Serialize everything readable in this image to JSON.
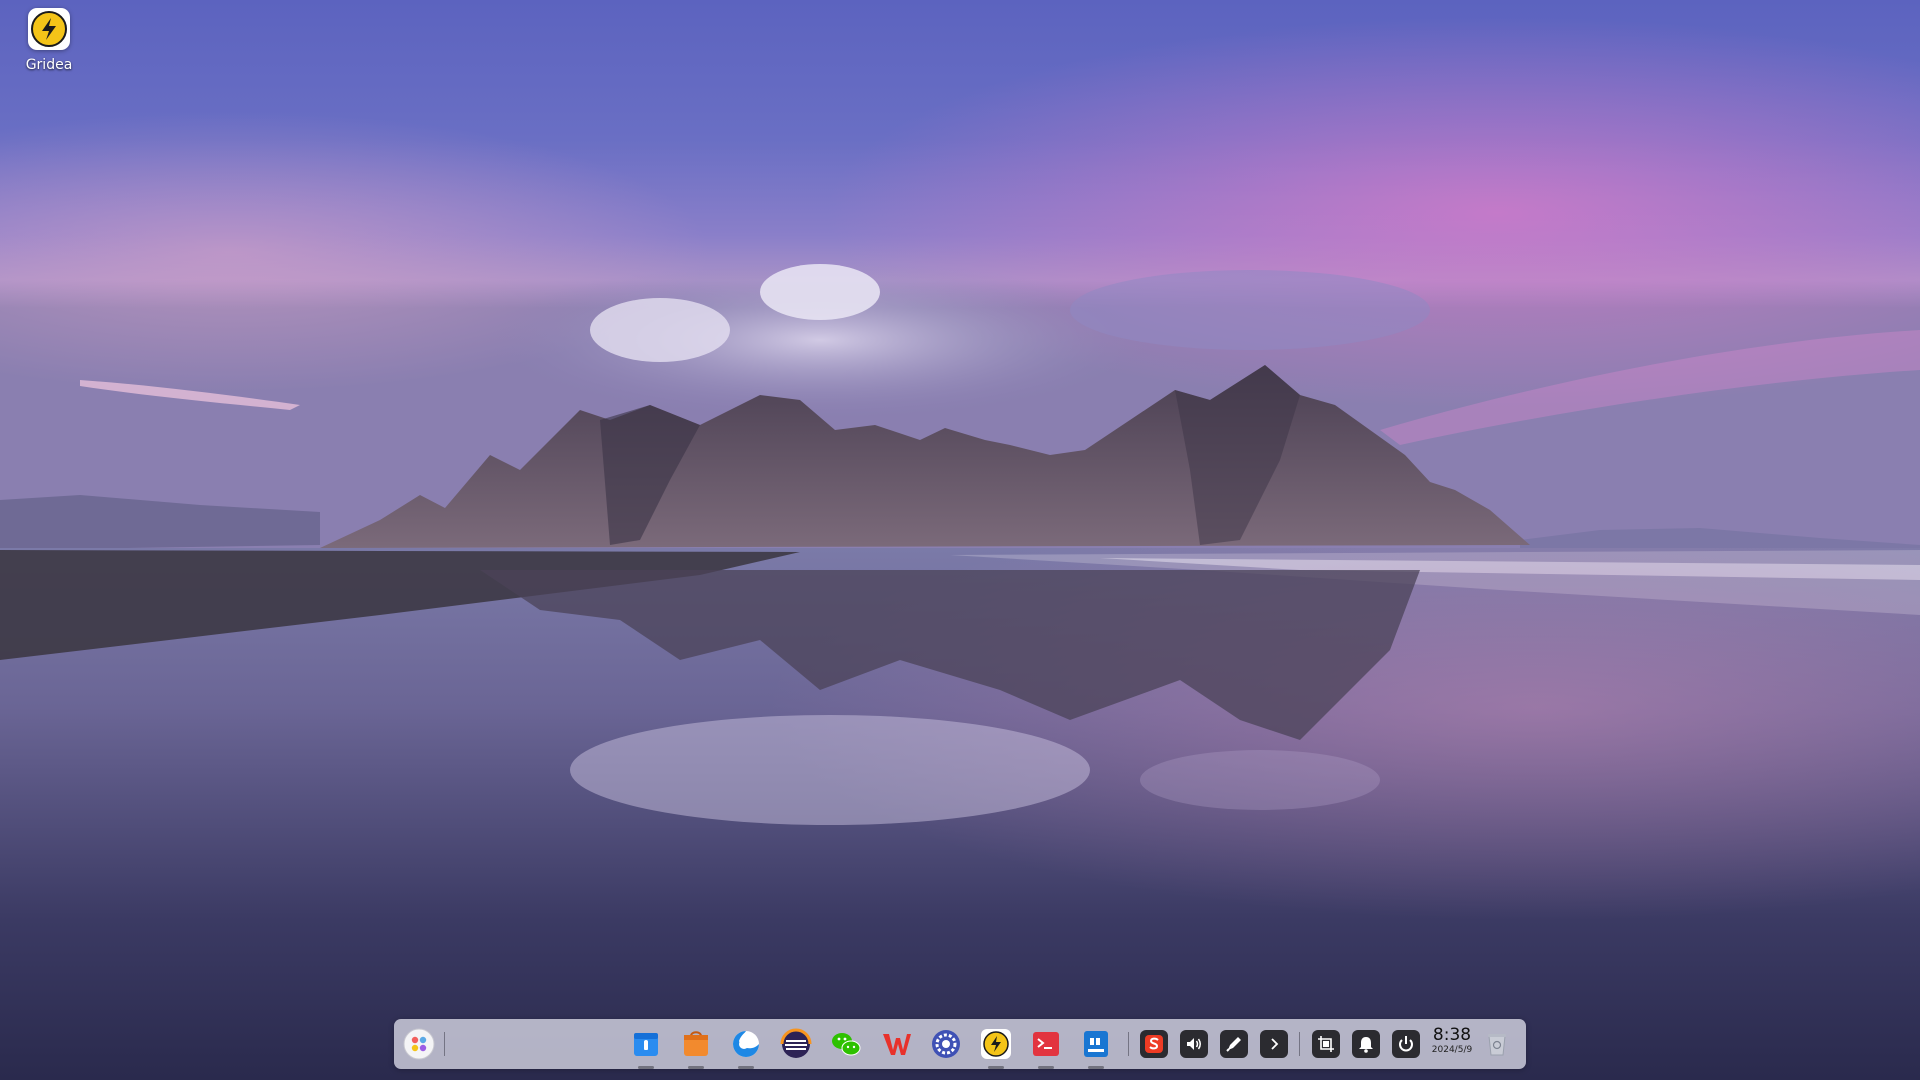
{
  "desktop": {
    "icons": [
      {
        "label": "Gridea",
        "icon": "gridea-icon"
      }
    ]
  },
  "dock": {
    "launcher_icon": "launcher-icon",
    "apps": [
      {
        "name": "file-manager",
        "icon": "file-manager-icon",
        "running": true
      },
      {
        "name": "app-store",
        "icon": "app-store-icon",
        "running": true
      },
      {
        "name": "browser",
        "icon": "browser-icon",
        "running": true
      },
      {
        "name": "eclipse",
        "icon": "eclipse-icon",
        "running": false
      },
      {
        "name": "wechat",
        "icon": "wechat-icon",
        "running": false
      },
      {
        "name": "wps-office",
        "icon": "wps-icon",
        "running": false
      },
      {
        "name": "settings",
        "icon": "settings-icon",
        "running": false
      },
      {
        "name": "gridea",
        "icon": "gridea-icon",
        "running": true
      },
      {
        "name": "terminal",
        "icon": "terminal-icon",
        "running": true
      },
      {
        "name": "notes",
        "icon": "notes-icon",
        "running": true
      }
    ],
    "tray": [
      {
        "name": "input-method",
        "icon": "sogou-input-icon"
      },
      {
        "name": "volume",
        "icon": "volume-icon"
      },
      {
        "name": "pen",
        "icon": "pen-icon"
      },
      {
        "name": "expand",
        "icon": "chevron-right-icon"
      },
      {
        "name": "screenshot",
        "icon": "screenshot-icon"
      },
      {
        "name": "notifications",
        "icon": "bell-icon"
      },
      {
        "name": "power",
        "icon": "power-icon"
      }
    ],
    "clock": {
      "time": "8:38",
      "date": "2024/5/9"
    },
    "trash_icon": "trash-icon"
  },
  "colors": {
    "accent_yellow": "#f4c418",
    "terminal_red": "#e2343f",
    "file_manager_blue": "#2a8cf0"
  }
}
